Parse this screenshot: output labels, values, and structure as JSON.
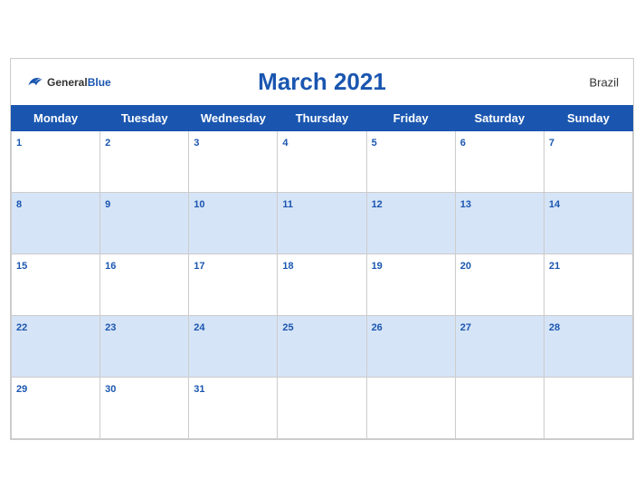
{
  "header": {
    "title": "March 2021",
    "country": "Brazil",
    "logo_general": "General",
    "logo_blue": "Blue"
  },
  "weekdays": [
    "Monday",
    "Tuesday",
    "Wednesday",
    "Thursday",
    "Friday",
    "Saturday",
    "Sunday"
  ],
  "weeks": [
    [
      {
        "day": 1,
        "hasDate": true
      },
      {
        "day": 2,
        "hasDate": true
      },
      {
        "day": 3,
        "hasDate": true
      },
      {
        "day": 4,
        "hasDate": true
      },
      {
        "day": 5,
        "hasDate": true
      },
      {
        "day": 6,
        "hasDate": true
      },
      {
        "day": 7,
        "hasDate": true
      }
    ],
    [
      {
        "day": 8,
        "hasDate": true
      },
      {
        "day": 9,
        "hasDate": true
      },
      {
        "day": 10,
        "hasDate": true
      },
      {
        "day": 11,
        "hasDate": true
      },
      {
        "day": 12,
        "hasDate": true
      },
      {
        "day": 13,
        "hasDate": true
      },
      {
        "day": 14,
        "hasDate": true
      }
    ],
    [
      {
        "day": 15,
        "hasDate": true
      },
      {
        "day": 16,
        "hasDate": true
      },
      {
        "day": 17,
        "hasDate": true
      },
      {
        "day": 18,
        "hasDate": true
      },
      {
        "day": 19,
        "hasDate": true
      },
      {
        "day": 20,
        "hasDate": true
      },
      {
        "day": 21,
        "hasDate": true
      }
    ],
    [
      {
        "day": 22,
        "hasDate": true
      },
      {
        "day": 23,
        "hasDate": true
      },
      {
        "day": 24,
        "hasDate": true
      },
      {
        "day": 25,
        "hasDate": true
      },
      {
        "day": 26,
        "hasDate": true
      },
      {
        "day": 27,
        "hasDate": true
      },
      {
        "day": 28,
        "hasDate": true
      }
    ],
    [
      {
        "day": 29,
        "hasDate": true
      },
      {
        "day": 30,
        "hasDate": true
      },
      {
        "day": 31,
        "hasDate": true
      },
      {
        "day": null,
        "hasDate": false
      },
      {
        "day": null,
        "hasDate": false
      },
      {
        "day": null,
        "hasDate": false
      },
      {
        "day": null,
        "hasDate": false
      }
    ]
  ],
  "colors": {
    "header_bg": "#1a56b0",
    "row_alt_bg": "#d6e4f7",
    "day_number_color": "#1a56b0"
  }
}
